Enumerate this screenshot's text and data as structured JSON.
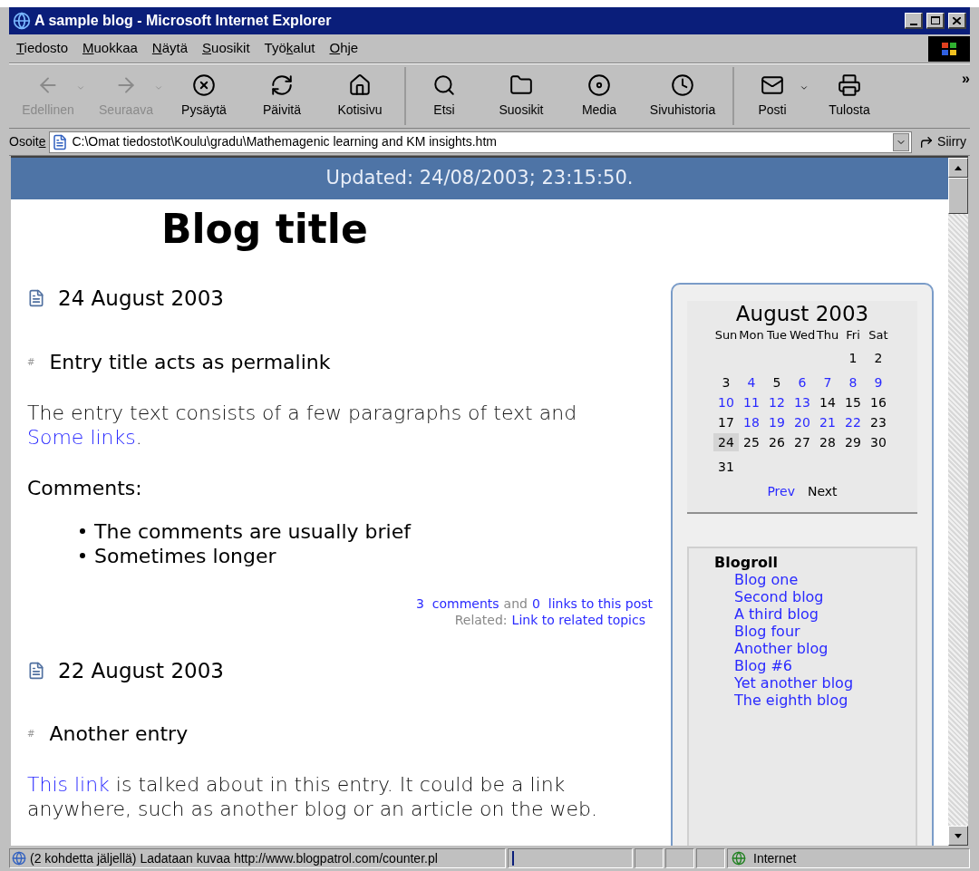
{
  "window": {
    "title": "A sample blog - Microsoft Internet Explorer"
  },
  "menu": [
    {
      "key": "T",
      "rest": "iedosto"
    },
    {
      "key": "M",
      "rest": "uokkaa"
    },
    {
      "key": "N",
      "rest": "äytä"
    },
    {
      "key": "S",
      "rest": "uosikit"
    },
    {
      "lead": "Työ",
      "key": "k",
      "rest": "alut"
    },
    {
      "key": "O",
      "rest": "hje"
    }
  ],
  "toolbar": [
    {
      "kind": "back",
      "label": "Edellinen",
      "disabled": true,
      "has_menu": true,
      "separator_before": false
    },
    {
      "kind": "forward",
      "label": "Seuraava",
      "disabled": true,
      "has_menu": true,
      "separator_before": false
    },
    {
      "kind": "stop",
      "label": "Pysäytä",
      "disabled": false,
      "has_menu": false,
      "separator_before": false
    },
    {
      "kind": "refresh",
      "label": "Päivitä",
      "disabled": false,
      "has_menu": false,
      "separator_before": false
    },
    {
      "kind": "home",
      "label": "Kotisivu",
      "disabled": false,
      "has_menu": false,
      "separator_before": false
    },
    {
      "kind": "search",
      "label": "Etsi",
      "disabled": false,
      "has_menu": false,
      "separator_before": true
    },
    {
      "kind": "favorites",
      "label": "Suosikit",
      "disabled": false,
      "has_menu": false,
      "separator_before": false
    },
    {
      "kind": "media",
      "label": "Media",
      "disabled": false,
      "has_menu": false,
      "separator_before": false
    },
    {
      "kind": "history",
      "label": "Sivuhistoria",
      "disabled": false,
      "has_menu": false,
      "separator_before": false
    },
    {
      "kind": "mail",
      "label": "Posti",
      "disabled": false,
      "has_menu": true,
      "separator_before": true
    },
    {
      "kind": "print",
      "label": "Tulosta",
      "disabled": false,
      "has_menu": false,
      "separator_before": false
    }
  ],
  "toolbar_more": "»",
  "address_bar": {
    "lead": "Osoit",
    "key": "e",
    "value": "C:\\Omat tiedostot\\Koulu\\gradu\\Mathemagenic learning and KM insights.htm",
    "go": "Siirry"
  },
  "page": {
    "updated": "Updated: 24/08/2003; 23:15:50.",
    "blog_title": "Blog title",
    "days": [
      {
        "date": "24 August 2003",
        "entries": [
          {
            "marker": "#",
            "title": "Entry title acts as permalink",
            "paragraphs": [
              [
                {
                  "text": "The entry text consists of a few paragraphs of text and ",
                  "link": false
                },
                {
                  "text": "Some links",
                  "link": true
                },
                {
                  "text": ".",
                  "link": false
                }
              ]
            ],
            "comments_label": "Comments:",
            "comments": [
              "The comments are usually brief",
              "Sometimes longer"
            ],
            "footer": {
              "comments_count": "3",
              "comments_link": "comments",
              "and": "and",
              "links_count": "0",
              "links_link": "links to this post",
              "related_label": "Related:",
              "related_link": "Link to related topics"
            }
          }
        ]
      },
      {
        "date": "22 August 2003",
        "entries": [
          {
            "marker": "#",
            "title": "Another entry",
            "paragraphs": [
              [
                {
                  "text": "This link",
                  "link": true
                },
                {
                  "text": " is talked about in this entry. It could be a link anywhere, such as another blog or an article on the web.",
                  "link": false
                }
              ]
            ]
          }
        ]
      }
    ],
    "calendar": {
      "month": "August 2003",
      "prev": "Prev",
      "next": "Next",
      "weekdays": [
        "Sun",
        "Mon",
        "Tue",
        "Wed",
        "Thu",
        "Fri",
        "Sat"
      ],
      "weeks": [
        [
          {
            "day": "1",
            "link": false,
            "selected": false
          },
          {
            "day": "2",
            "link": false,
            "selected": false
          }
        ],
        [
          {
            "day": "3",
            "link": false,
            "selected": false
          },
          {
            "day": "4",
            "link": true,
            "selected": false
          },
          {
            "day": "5",
            "link": false,
            "selected": false
          },
          {
            "day": "6",
            "link": true,
            "selected": false
          },
          {
            "day": "7",
            "link": true,
            "selected": false
          },
          {
            "day": "8",
            "link": true,
            "selected": false
          },
          {
            "day": "9",
            "link": true,
            "selected": false
          }
        ],
        [
          {
            "day": "10",
            "link": true,
            "selected": false
          },
          {
            "day": "11",
            "link": true,
            "selected": false
          },
          {
            "day": "12",
            "link": true,
            "selected": false
          },
          {
            "day": "13",
            "link": true,
            "selected": false
          },
          {
            "day": "14",
            "link": false,
            "selected": false
          },
          {
            "day": "15",
            "link": false,
            "selected": false
          },
          {
            "day": "16",
            "link": false,
            "selected": false
          }
        ],
        [
          {
            "day": "17",
            "link": false,
            "selected": false
          },
          {
            "day": "18",
            "link": true,
            "selected": false
          },
          {
            "day": "19",
            "link": true,
            "selected": false
          },
          {
            "day": "20",
            "link": true,
            "selected": false
          },
          {
            "day": "21",
            "link": true,
            "selected": false
          },
          {
            "day": "22",
            "link": true,
            "selected": false
          },
          {
            "day": "23",
            "link": false,
            "selected": false
          }
        ],
        [
          {
            "day": "24",
            "link": false,
            "selected": true
          },
          {
            "day": "25",
            "link": false,
            "selected": false
          },
          {
            "day": "26",
            "link": false,
            "selected": false
          },
          {
            "day": "27",
            "link": false,
            "selected": false
          },
          {
            "day": "28",
            "link": false,
            "selected": false
          },
          {
            "day": "29",
            "link": false,
            "selected": false
          },
          {
            "day": "30",
            "link": false,
            "selected": false
          }
        ],
        [
          {
            "day": "31",
            "link": false,
            "selected": false
          }
        ]
      ]
    },
    "blogroll": {
      "title": "Blogroll",
      "items": [
        "Blog one",
        "Second blog",
        "A third blog",
        "Blog four",
        "Another blog",
        "Blog #6",
        "Yet another blog",
        "The eighth blog"
      ]
    }
  },
  "status_bar": {
    "text": "(2 kohdetta jäljellä) Ladataan kuvaa http://www.blogpatrol.com/counter.pl",
    "zone": "Internet"
  }
}
